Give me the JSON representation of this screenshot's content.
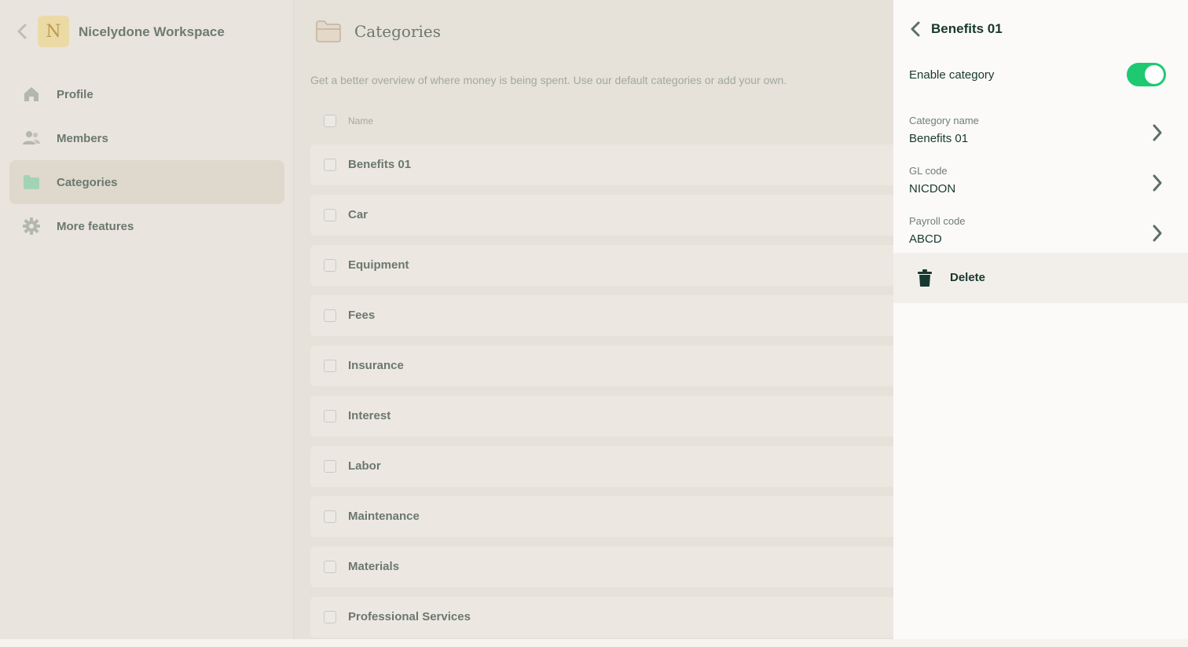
{
  "workspace": {
    "logo_letter": "N",
    "name": "Nicelydone Workspace"
  },
  "sidebar": {
    "items": [
      {
        "label": "Profile",
        "icon": "home-icon",
        "active": false
      },
      {
        "label": "Members",
        "icon": "people-icon",
        "active": false
      },
      {
        "label": "Categories",
        "icon": "folder-icon",
        "active": true
      },
      {
        "label": "More features",
        "icon": "gear-icon",
        "active": false
      }
    ]
  },
  "main": {
    "title": "Categories",
    "description": "Get a better overview of where money is being spent. Use our default categories or add your own.",
    "table": {
      "column_name": "Name",
      "rows": [
        "Benefits 01",
        "Car",
        "Equipment",
        "Fees",
        "Insurance",
        "Interest",
        "Labor",
        "Maintenance",
        "Materials",
        "Professional Services"
      ]
    }
  },
  "panel": {
    "title": "Benefits 01",
    "enable_label": "Enable category",
    "enabled": true,
    "fields": [
      {
        "label": "Category name",
        "value": "Benefits 01"
      },
      {
        "label": "GL code",
        "value": "NICDON"
      },
      {
        "label": "Payroll code",
        "value": "ABCD"
      }
    ],
    "delete_label": "Delete"
  },
  "colors": {
    "accent_green": "#1ec972",
    "dark_green_text": "#17392f",
    "workspace_logo_bg": "#fde9a0",
    "folder_icon_green": "#5fd49a"
  }
}
